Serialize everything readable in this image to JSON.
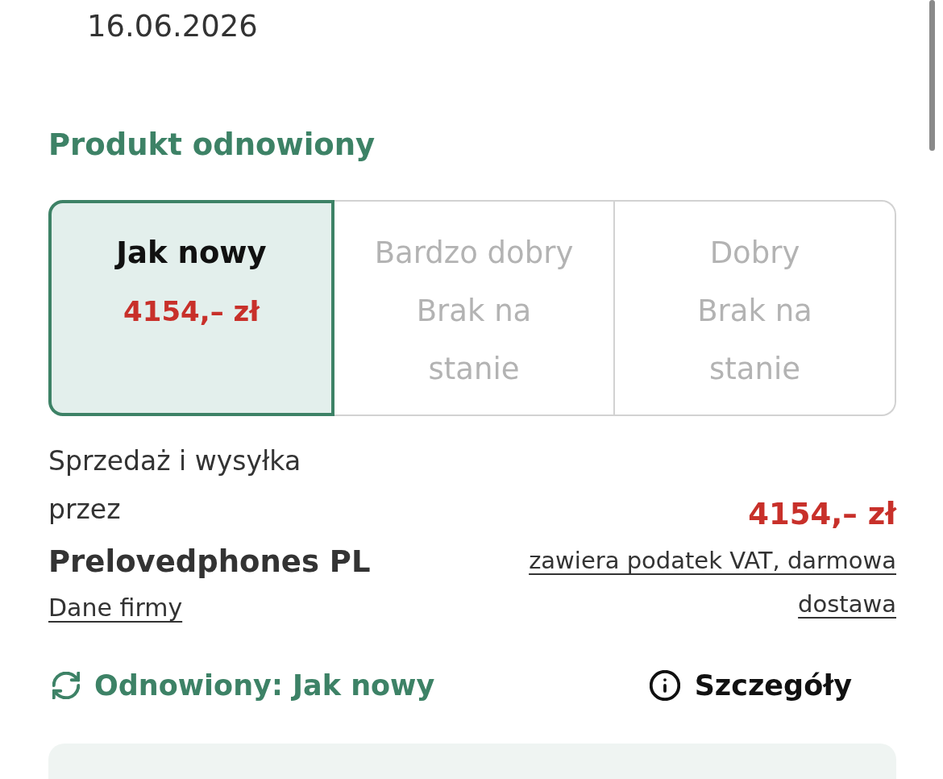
{
  "date": "16.06.2026",
  "section_title": "Produkt odnowiony",
  "conditions": [
    {
      "label": "Jak nowy",
      "status": "4154,– zł",
      "selected": true,
      "available": true
    },
    {
      "label": "Bardzo dobry",
      "status": "Brak na stanie",
      "selected": false,
      "available": false
    },
    {
      "label": "Dobry",
      "status": "Brak na stanie",
      "selected": false,
      "available": false
    }
  ],
  "seller": {
    "intro": "Sprzedaż i wysyłka przez",
    "name": "Prelovedphones PL",
    "link": "Dane firmy"
  },
  "offer": {
    "price": "4154,– zł",
    "note": "zawiera podatek VAT, darmowa dostawa"
  },
  "condition_badge": {
    "text": "Odnowiony: Jak nowy"
  },
  "details_link": {
    "label": "Szczegóły"
  }
}
